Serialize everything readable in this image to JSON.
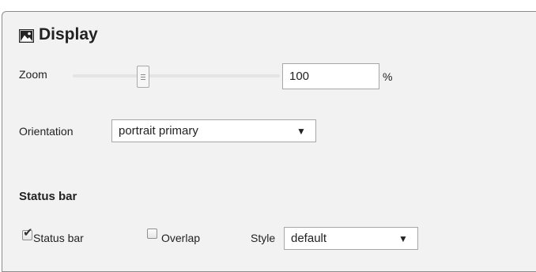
{
  "display": {
    "title": "Display",
    "icon": "image-icon",
    "zoom": {
      "label": "Zoom",
      "value": "100",
      "unit": "%"
    },
    "orientation": {
      "label": "Orientation",
      "selected": "portrait primary"
    }
  },
  "status_bar": {
    "heading": "Status bar",
    "status_bar_checkbox": {
      "label": "Status bar",
      "checked": true
    },
    "overlap_checkbox": {
      "label": "Overlap",
      "checked": false
    },
    "style": {
      "label": "Style",
      "selected": "default"
    }
  }
}
